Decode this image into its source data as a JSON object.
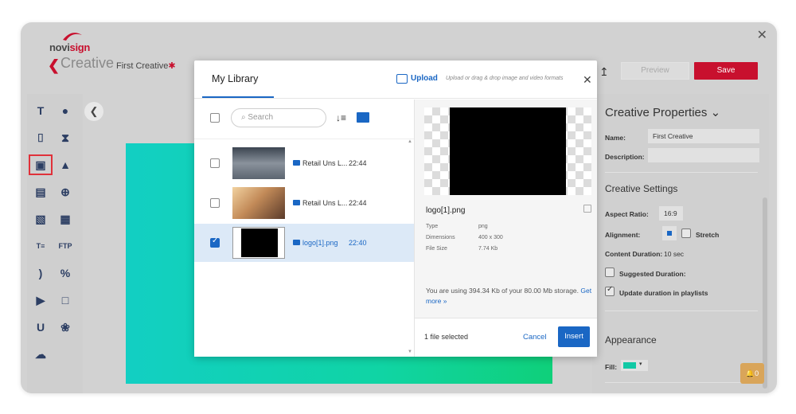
{
  "app": {
    "brand_prefix": "novi",
    "brand_suffix": "sign",
    "section_title": "Creative",
    "creative_name": "First Creative",
    "unsaved_marker": "✱",
    "preview_label": "Preview",
    "save_label": "Save",
    "close_glyph": "✕",
    "back_glyph": "❮",
    "collapse_glyph": "❮"
  },
  "colors": {
    "brand_red": "#c8102e",
    "accent_blue": "#1a67c4",
    "canvas_gradient_start": "#12cfc3",
    "canvas_gradient_end": "#0fd07a"
  },
  "toolbar": {
    "items": [
      {
        "icon": "text-icon",
        "glyph": "T"
      },
      {
        "icon": "clock-icon",
        "glyph": "●"
      },
      {
        "icon": "ticker-icon",
        "glyph": "⌷"
      },
      {
        "icon": "hourglass-icon",
        "glyph": "⧗"
      },
      {
        "icon": "image-icon",
        "glyph": "▣"
      },
      {
        "icon": "shapes-icon",
        "glyph": "▲"
      },
      {
        "icon": "video-icon",
        "glyph": "▤"
      },
      {
        "icon": "globe-icon",
        "glyph": "⊕"
      },
      {
        "icon": "slideshow-icon",
        "glyph": "▧"
      },
      {
        "icon": "web-image-icon",
        "glyph": "▦"
      },
      {
        "icon": "text-list-icon",
        "glyph": "T≡"
      },
      {
        "icon": "ftp-icon",
        "glyph": "FTP"
      },
      {
        "icon": "rss-icon",
        "glyph": ")"
      },
      {
        "icon": "speech-icon",
        "glyph": "%"
      },
      {
        "icon": "youtube-icon",
        "glyph": "▶"
      },
      {
        "icon": "screen-icon",
        "glyph": "□"
      },
      {
        "icon": "u-icon",
        "glyph": "U"
      },
      {
        "icon": "twitter-icon",
        "glyph": "❀"
      },
      {
        "icon": "weather-icon",
        "glyph": "☁"
      }
    ],
    "selected_icon": "image-icon"
  },
  "library": {
    "title": "My Library",
    "upload_label": "Upload",
    "upload_hint": "Upload or drag & drop image and video formats",
    "search_placeholder": "Search",
    "files": [
      {
        "name": "Retail Uns L...",
        "time": "22:44",
        "selected": false,
        "thumb_color": "#6b7480"
      },
      {
        "name": "Retail Uns L...",
        "time": "22:44",
        "selected": false,
        "thumb_color": "#c29a6b"
      },
      {
        "name": "logo[1].png",
        "time": "22:40",
        "selected": true,
        "thumb_color": "#000000"
      }
    ],
    "detail": {
      "filename": "logo[1].png",
      "type_label": "Type",
      "type_value": "png",
      "dimensions_label": "Dimensions",
      "dimensions_value": "400 x 300",
      "size_label": "File Size",
      "size_value": "7.74 Kb"
    },
    "storage_text": "You are using 394.34 Kb of your 80.00 Mb storage.",
    "storage_link": "Get more »",
    "selected_count": "1 file selected",
    "cancel_label": "Cancel",
    "insert_label": "Insert"
  },
  "properties": {
    "title": "Creative Properties",
    "name_label": "Name:",
    "name_value": "First Creative",
    "description_label": "Description:",
    "description_value": "",
    "settings_title": "Creative Settings",
    "aspect_label": "Aspect Ratio:",
    "aspect_value": "16:9",
    "alignment_label": "Alignment:",
    "stretch_label": "Stretch",
    "duration_label": "Content Duration:",
    "duration_value": "10 sec",
    "suggested_label": "Suggested Duration:",
    "update_label": "Update duration in playlists",
    "appearance_title": "Appearance",
    "fill_label": "Fill:",
    "fill_color": "#12c9a5"
  },
  "notifications": {
    "count": "0"
  }
}
